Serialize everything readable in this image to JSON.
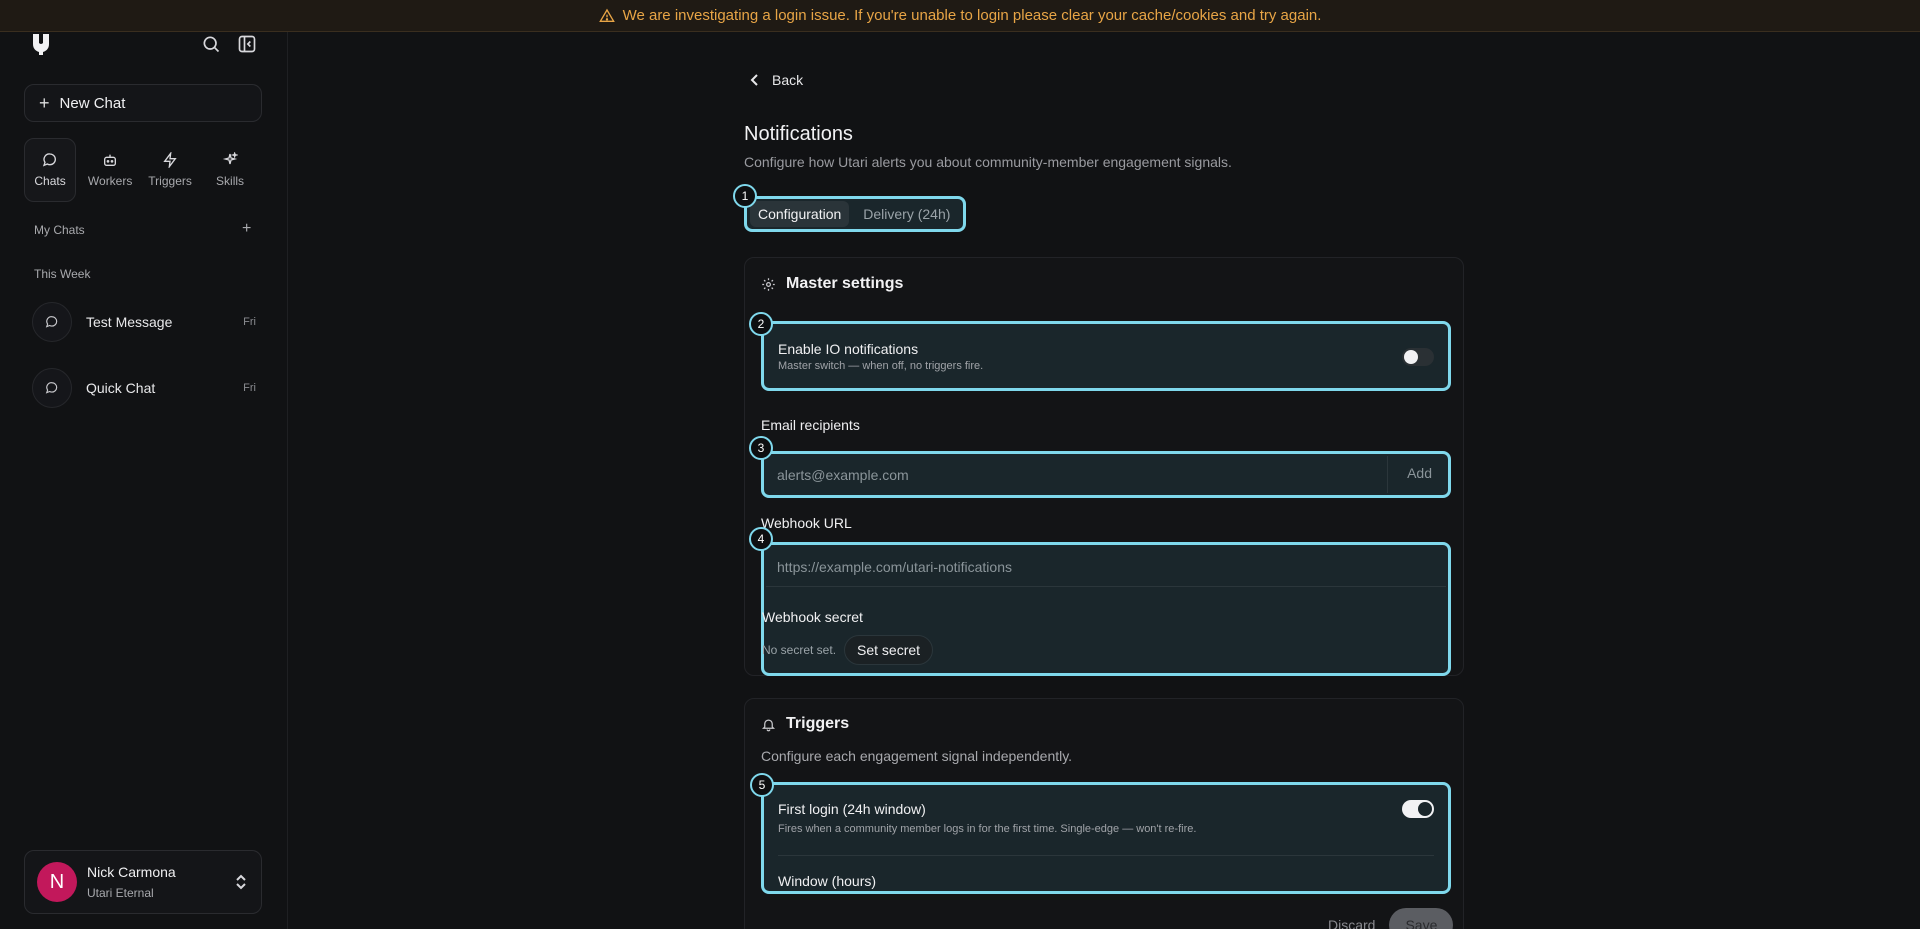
{
  "banner": {
    "text": "We are investigating a login issue. If you're unable to login please clear your cache/cookies and try again.",
    "color": "#e8a546"
  },
  "sidebar": {
    "new_chat_label": "New Chat",
    "nav": [
      {
        "label": "Chats",
        "icon": "chat-icon",
        "active": true
      },
      {
        "label": "Workers",
        "icon": "robot-icon",
        "active": false
      },
      {
        "label": "Triggers",
        "icon": "bolt-icon",
        "active": false
      },
      {
        "label": "Skills",
        "icon": "sparkles-icon",
        "active": false
      }
    ],
    "my_chats_label": "My Chats",
    "this_week_label": "This Week",
    "chats": [
      {
        "title": "Test Message",
        "time": "Fri"
      },
      {
        "title": "Quick Chat",
        "time": "Fri"
      }
    ],
    "user": {
      "initial": "N",
      "name": "Nick Carmona",
      "org": "Utari Eternal",
      "avatar_color": "#c2185b"
    }
  },
  "main": {
    "back_label": "Back",
    "title": "Notifications",
    "subtitle": "Configure how Utari alerts you about community-member engagement signals.",
    "tabs": [
      {
        "label": "Configuration",
        "active": true
      },
      {
        "label": "Delivery (24h)",
        "active": false
      }
    ],
    "master": {
      "heading": "Master settings",
      "enable_title": "Enable IO notifications",
      "enable_desc": "Master switch — when off, no triggers fire.",
      "enable_on": false,
      "email_label": "Email recipients",
      "email_placeholder": "alerts@example.com",
      "add_label": "Add",
      "webhook_label": "Webhook URL",
      "webhook_placeholder": "https://example.com/utari-notifications",
      "secret_label": "Webhook secret",
      "secret_status": "No secret set.",
      "set_secret_label": "Set secret"
    },
    "triggers": {
      "heading": "Triggers",
      "subtitle": "Configure each engagement signal independently.",
      "first_login_title": "First login (24h window)",
      "first_login_desc": "Fires when a community member logs in for the first time. Single-edge — won't re-fire.",
      "first_login_on": true,
      "window_label": "Window (hours)"
    },
    "discard_label": "Discard",
    "save_label": "Save"
  },
  "annotations": [
    "1",
    "2",
    "3",
    "4",
    "5"
  ],
  "highlight_color": "#7fd8ec"
}
